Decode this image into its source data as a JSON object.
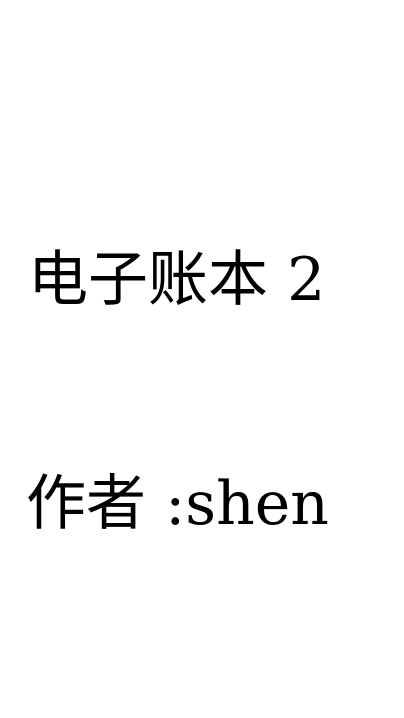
{
  "document": {
    "title": "电子账本 2",
    "author_line": "作者 :shen"
  }
}
